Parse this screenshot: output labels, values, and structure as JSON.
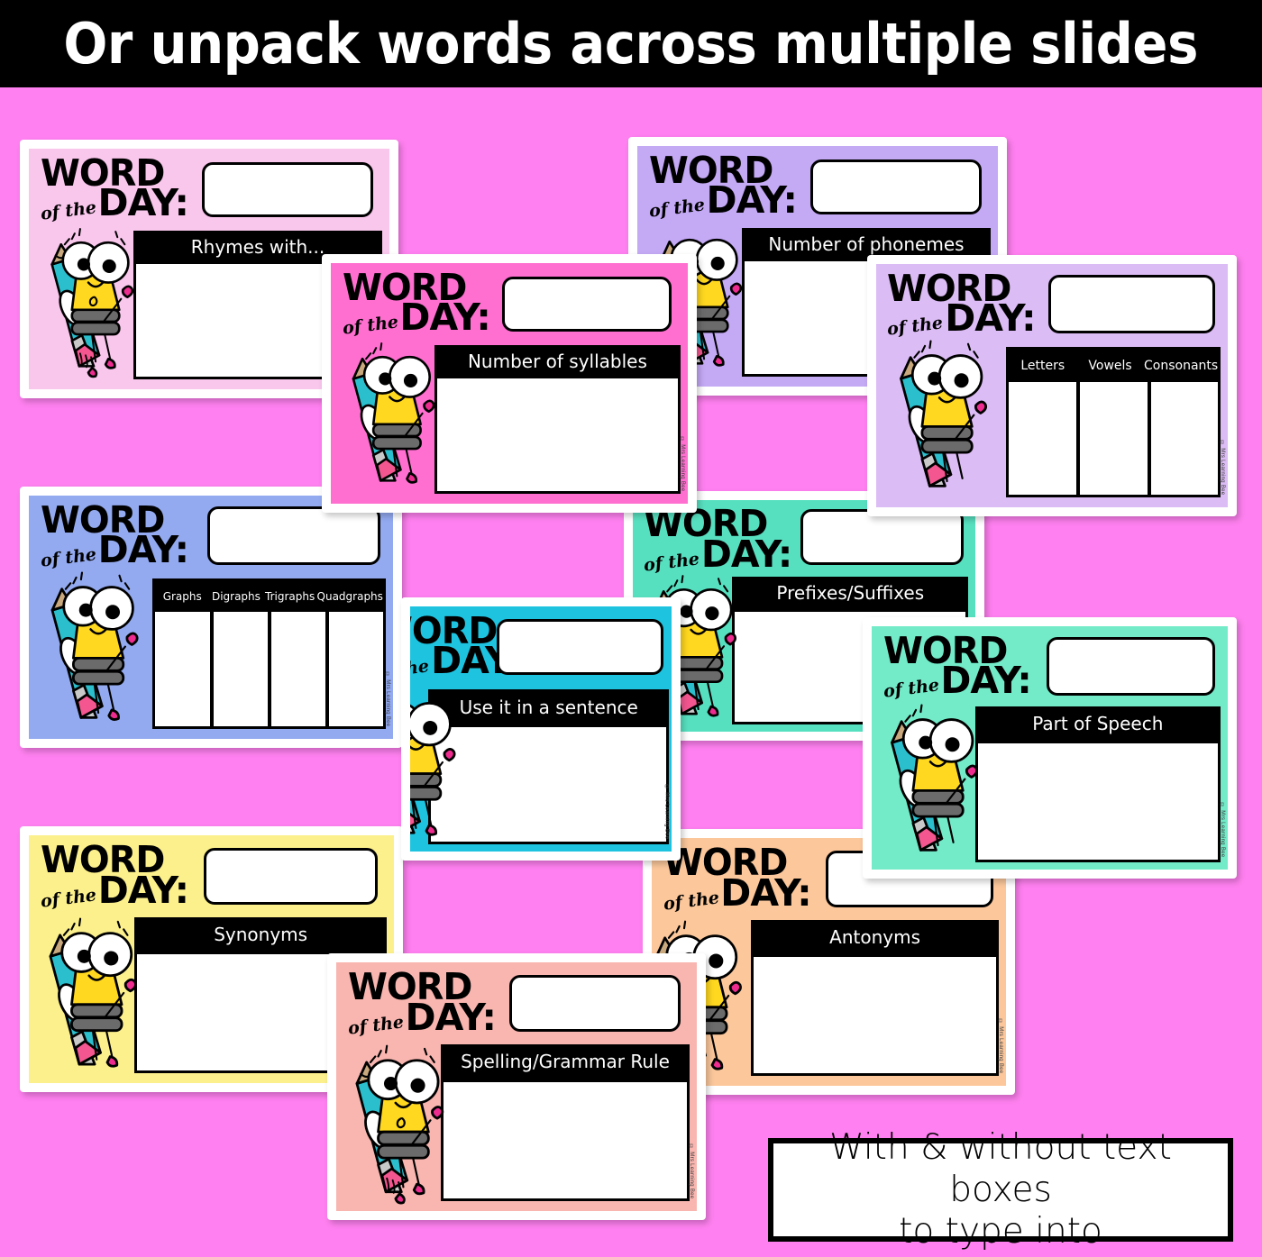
{
  "banner": {
    "title": "Or unpack words across multiple slides"
  },
  "common": {
    "word_line1": "WORD",
    "word_ofthe": "of the",
    "word_day": "DAY:",
    "word_input_value": "",
    "copyright": "© Mrs Learning Bee"
  },
  "caption": {
    "line1": "With & without text boxes",
    "line2": "to type into"
  },
  "colors": {
    "background": "#FF80F0",
    "banner": "#000000",
    "card_frame": "#FFFFFF",
    "card_rhymes": "#F9C6EC",
    "card_syllables": "#FF6FD0",
    "card_phonemes": "#C4A9F5",
    "card_letters": "#DCBCF5",
    "card_graphs": "#93AAF0",
    "card_sentence": "#1EC3E0",
    "card_prefixes": "#57E0C0",
    "card_partofspeech": "#73EAC8",
    "card_synonyms": "#FCF08C",
    "card_antonyms": "#FBC79B",
    "card_spelling": "#F9B6B0"
  },
  "cards": [
    {
      "id": "rhymes",
      "label": "Rhymes with...",
      "bg": "#F9C6EC",
      "type": "box"
    },
    {
      "id": "phonemes",
      "label": "Number of phonemes",
      "bg": "#C4A9F5",
      "type": "box"
    },
    {
      "id": "syllables",
      "label": "Number of syllables",
      "bg": "#FF6FD0",
      "type": "box"
    },
    {
      "id": "letters",
      "label": "",
      "bg": "#DCBCF5",
      "type": "table",
      "columns": [
        "Letters",
        "Vowels",
        "Consonants"
      ]
    },
    {
      "id": "graphs",
      "label": "",
      "bg": "#93AAF0",
      "type": "table",
      "columns": [
        "Graphs",
        "Digraphs",
        "Trigraphs",
        "Quadgraphs"
      ]
    },
    {
      "id": "prefixes",
      "label": "Prefixes/Suffixes",
      "bg": "#57E0C0",
      "type": "box"
    },
    {
      "id": "sentence",
      "label": "Use it in a sentence",
      "bg": "#1EC3E0",
      "type": "box"
    },
    {
      "id": "partofspeech",
      "label": "Part of Speech",
      "bg": "#73EAC8",
      "type": "box"
    },
    {
      "id": "synonyms",
      "label": "Synonyms",
      "bg": "#FCF08C",
      "type": "box"
    },
    {
      "id": "antonyms",
      "label": "Antonyms",
      "bg": "#FBC79B",
      "type": "box"
    },
    {
      "id": "spelling",
      "label": "Spelling/Grammar Rule",
      "bg": "#F9B6B0",
      "type": "box"
    }
  ]
}
